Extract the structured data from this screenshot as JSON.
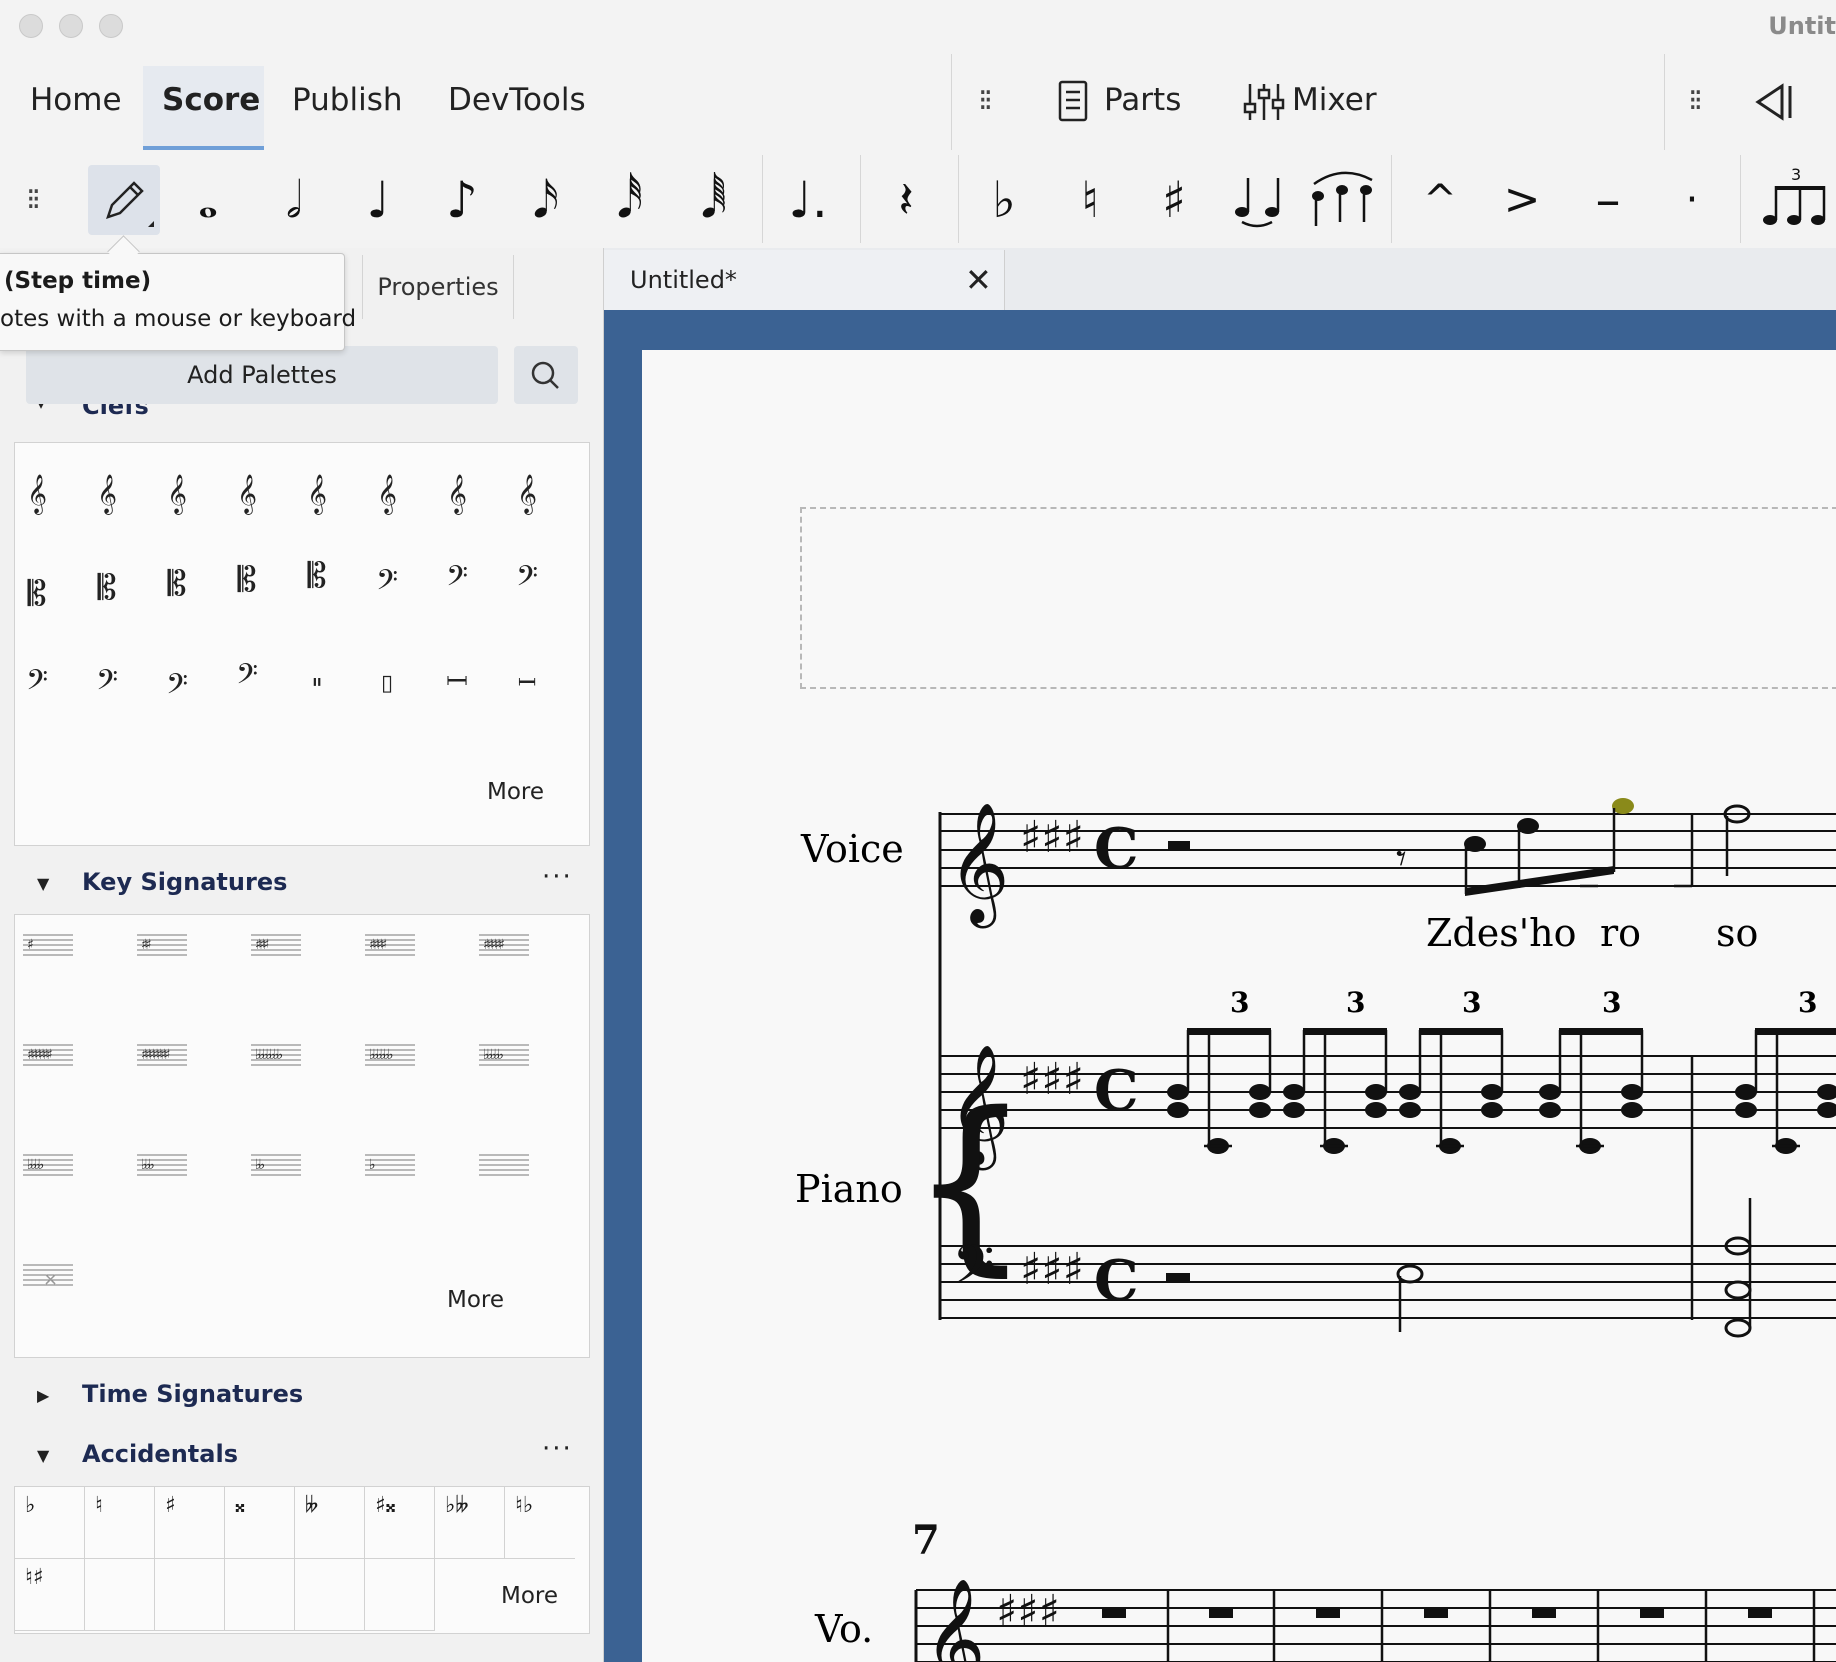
{
  "window": {
    "title": "Untit"
  },
  "menu_tabs": [
    {
      "label": "Home",
      "selected": false
    },
    {
      "label": "Score",
      "selected": true
    },
    {
      "label": "Publish",
      "selected": false
    },
    {
      "label": "DevTools",
      "selected": false
    }
  ],
  "top_buttons": {
    "parts": "Parts",
    "mixer": "Mixer"
  },
  "toolbar": {
    "items": [
      "pencil-icon",
      "whole-note-icon",
      "half-note-icon",
      "quarter-note-icon",
      "eighth-note-icon",
      "sixteenth-note-icon",
      "thirty-second-note-icon",
      "sixty-fourth-note-icon",
      "augmentation-dot-icon",
      "rest-icon",
      "flat-icon",
      "natural-icon",
      "sharp-icon",
      "tie-icon",
      "slur-icon",
      "marcato-icon",
      "accent-icon",
      "tenuto-icon",
      "staccato-icon",
      "tuplet-icon"
    ],
    "tuplet_number": "3"
  },
  "tooltip": {
    "title": "(Step time)",
    "body": "otes with a mouse or keyboard"
  },
  "panel": {
    "properties_tab": "Properties",
    "add_palettes": "Add Palettes",
    "sections": {
      "clefs": {
        "title": "Clefs",
        "more": "More"
      },
      "key_signatures": {
        "title": "Key Signatures",
        "more": "More"
      },
      "time_signatures": {
        "title": "Time Signatures"
      },
      "accidentals": {
        "title": "Accidentals",
        "more": "More"
      }
    }
  },
  "document": {
    "tab_label": "Untitled*",
    "instruments": [
      "Voice",
      "Piano"
    ],
    "short_instrument": "Vo.",
    "lyrics": [
      "Zdes'ho",
      "ro",
      "so"
    ],
    "tuplet_numbers": [
      "3",
      "3",
      "3",
      "3",
      "3"
    ],
    "measure_number": "7"
  },
  "colors": {
    "accent_blue": "#3b6293",
    "selected_note": "#8a8a1a",
    "tab_underline": "#6f9fd8"
  }
}
